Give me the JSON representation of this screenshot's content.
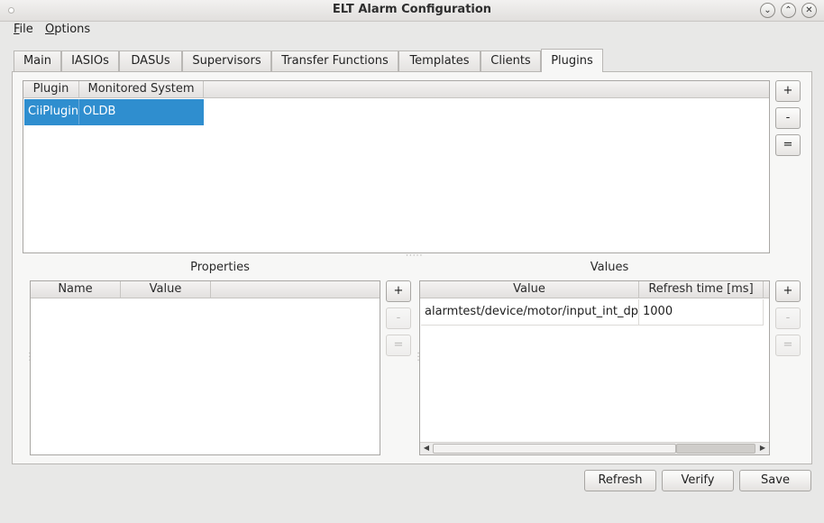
{
  "window": {
    "title": "ELT Alarm Configuration",
    "controls": {
      "minimize": "⌄",
      "maximize": "⌃",
      "close": "✕"
    }
  },
  "menu": [
    {
      "mnemonic": "F",
      "rest": "ile"
    },
    {
      "mnemonic": "O",
      "rest": "ptions"
    }
  ],
  "tabs": [
    "Main",
    "IASIOs",
    "DASUs",
    "Supervisors",
    "Transfer Functions",
    "Templates",
    "Clients",
    "Plugins"
  ],
  "active_tab": "Plugins",
  "plugins_table": {
    "headers": [
      "Plugin",
      "Monitored System"
    ],
    "rows": [
      {
        "plugin": "CiiPlugin",
        "system": "OLDB",
        "selected": true
      }
    ]
  },
  "properties": {
    "label": "Properties",
    "headers": [
      "Name",
      "Value"
    ],
    "rows": []
  },
  "values": {
    "label": "Values",
    "headers": [
      "Value",
      "Refresh time [ms]"
    ],
    "rows": [
      {
        "value": "alarmtest/device/motor/input_int_dp",
        "refresh": "1000"
      }
    ]
  },
  "side_buttons": {
    "add": "+",
    "remove": "-",
    "equal": "="
  },
  "scroll_arrows": {
    "left": "◀",
    "right": "▶"
  },
  "actions": {
    "refresh": "Refresh",
    "verify": "Verify",
    "save": "Save"
  },
  "colors": {
    "selection": "#2f8ecf",
    "background": "#e8e8e7"
  }
}
